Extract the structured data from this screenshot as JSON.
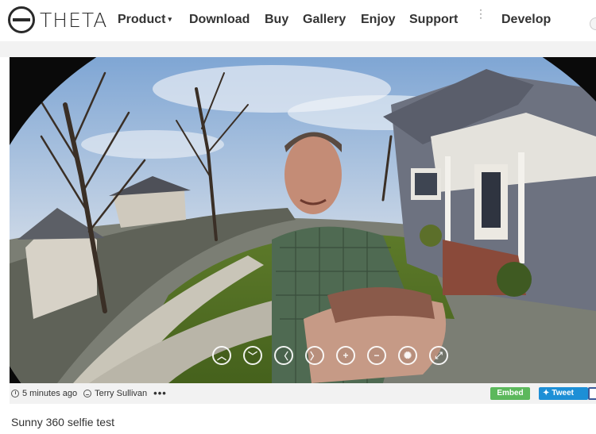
{
  "header": {
    "logo_text": "THETA",
    "nav": [
      {
        "label": "Product",
        "has_caret": true
      },
      {
        "label": "Download"
      },
      {
        "label": "Buy"
      },
      {
        "label": "Gallery"
      },
      {
        "label": "Enjoy"
      },
      {
        "label": "Support"
      },
      {
        "label": "Develop"
      }
    ],
    "caret_glyph": "▾",
    "more_glyph": "⋮"
  },
  "viewer": {
    "controls": [
      {
        "icon": "chevron-up-icon",
        "glyph": "︿"
      },
      {
        "icon": "chevron-down-icon",
        "glyph": "﹀"
      },
      {
        "icon": "chevron-left-icon",
        "glyph": "〈"
      },
      {
        "icon": "chevron-right-icon",
        "glyph": "〉"
      },
      {
        "icon": "zoom-in-icon",
        "glyph": "+"
      },
      {
        "icon": "zoom-out-icon",
        "glyph": "−"
      },
      {
        "icon": "autoplay-icon",
        "glyph": "✺"
      },
      {
        "icon": "fullscreen-icon",
        "glyph": "⤢"
      }
    ]
  },
  "meta": {
    "timestamp": "5 minutes ago",
    "author": "Terry Sullivan",
    "more": "•••",
    "embed_label": "Embed",
    "tweet_label": "Tweet"
  },
  "post": {
    "title": "Sunny 360 selfie test"
  },
  "colors": {
    "embed": "#5cb85c",
    "tweet": "#1d8fd6",
    "facebook": "#3b5998"
  }
}
